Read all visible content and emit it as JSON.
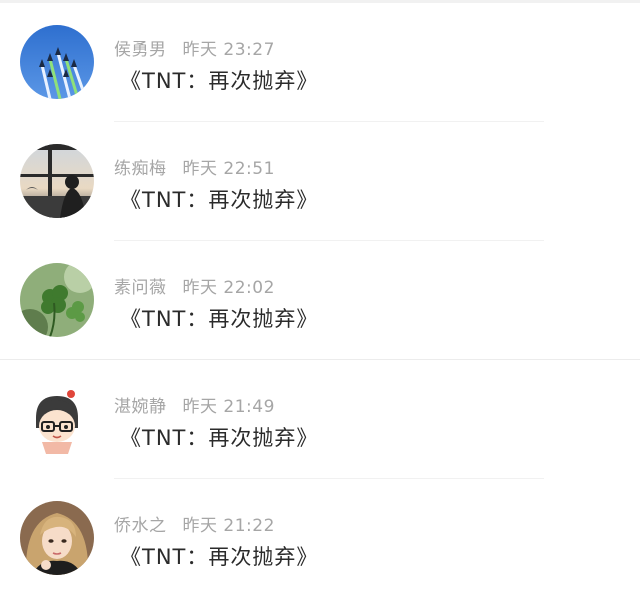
{
  "messages": [
    {
      "name": "侯勇男",
      "time": "昨天 23:27",
      "text": "《TNT：再次抛弃》",
      "avatar_icon": "airplanes-avatar-icon"
    },
    {
      "name": "练痴梅",
      "time": "昨天 22:51",
      "text": "《TNT：再次抛弃》",
      "avatar_icon": "window-silhouette-avatar-icon"
    },
    {
      "name": "素问薇",
      "time": "昨天 22:02",
      "text": "《TNT：再次抛弃》",
      "avatar_icon": "clover-plant-avatar-icon"
    },
    {
      "name": "湛婉静",
      "time": "昨天 21:49",
      "text": "《TNT：再次抛弃》",
      "avatar_icon": "cartoon-girl-glasses-avatar-icon"
    },
    {
      "name": "侨水之",
      "time": "昨天 21:22",
      "text": "《TNT：再次抛弃》",
      "avatar_icon": "girl-photo-avatar-icon"
    }
  ]
}
